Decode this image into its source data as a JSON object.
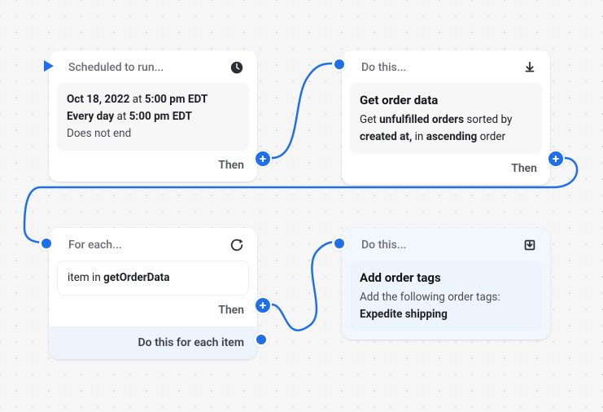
{
  "card1": {
    "header": "Scheduled to run...",
    "date": "Oct 18, 2022",
    "at1": " at ",
    "time1": "5:00 pm EDT",
    "repeat": "Every day",
    "at2": " at ",
    "time2": "5:00 pm EDT",
    "end": "Does not end",
    "then": "Then"
  },
  "card2": {
    "header": "Do this...",
    "title": "Get order data",
    "l1a": "Get ",
    "l1b": "unfulfilled orders",
    "l1c": " sorted by",
    "l2a": "created at,",
    "l2b": " in ",
    "l2c": "ascending",
    "l2d": " order",
    "then": "Then"
  },
  "card3": {
    "header": "For each...",
    "body_a": "item in ",
    "body_b": "getOrderData",
    "then": "Then",
    "footer": "Do this for each item"
  },
  "card4": {
    "header": "Do this...",
    "title": "Add order tags",
    "sub": "Add the following order tags:",
    "tag": "Expedite shipping"
  }
}
